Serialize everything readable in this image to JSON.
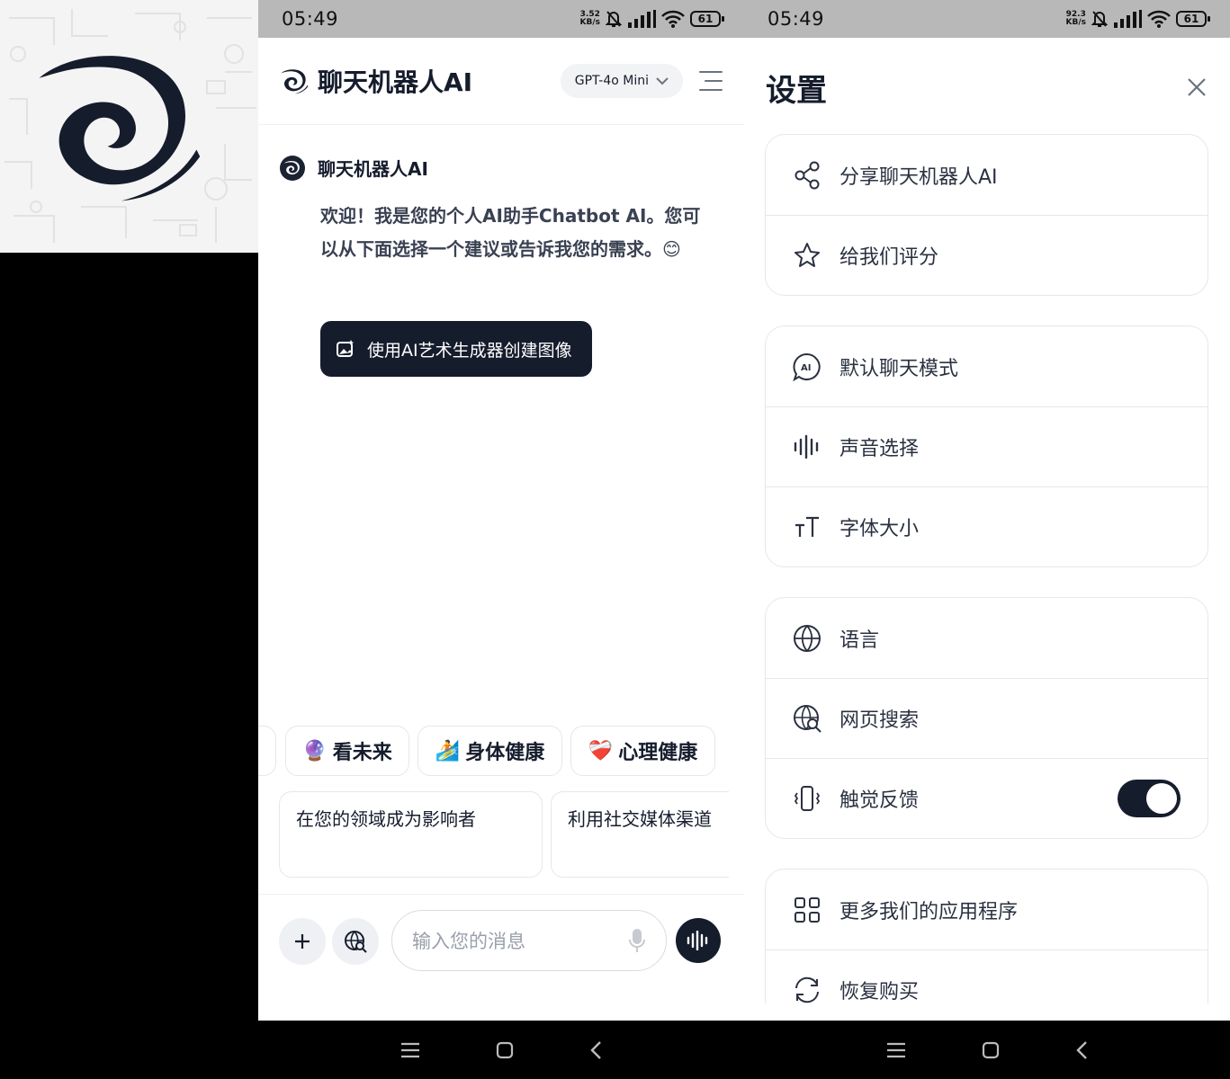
{
  "status_bar_left": {
    "time": "05:49",
    "speed_value": "3.52",
    "speed_unit": "KB/s",
    "battery": "61"
  },
  "status_bar_right": {
    "time": "05:49",
    "speed_value": "92.3",
    "speed_unit": "KB/s",
    "battery": "61"
  },
  "chat": {
    "app_title": "聊天机器人AI",
    "model": "GPT-4o Mini",
    "bot_name": "聊天机器人AI",
    "welcome": "欢迎！我是您的个人AI助手Chatbot AI。您可以从下面选择一个建议或告诉我您的需求。😊",
    "art_button": "使用AI艺术生成器创建图像",
    "chips": [
      {
        "emoji": "🔮",
        "label": "看未来"
      },
      {
        "emoji": "🏄",
        "label": "身体健康"
      },
      {
        "emoji": "❤️‍🩹",
        "label": "心理健康"
      }
    ],
    "prompts": [
      "在您的领域成为影响者",
      "利用社交媒体渠道"
    ],
    "input_placeholder": "输入您的消息"
  },
  "settings": {
    "title": "设置",
    "groups": [
      [
        {
          "icon": "share-icon",
          "label": "分享聊天机器人AI"
        },
        {
          "icon": "star-icon",
          "label": "给我们评分"
        }
      ],
      [
        {
          "icon": "ai-chat-icon",
          "label": "默认聊天模式"
        },
        {
          "icon": "waveform-icon",
          "label": "声音选择"
        },
        {
          "icon": "font-size-icon",
          "label": "字体大小"
        }
      ],
      [
        {
          "icon": "globe-icon",
          "label": "语言"
        },
        {
          "icon": "web-search-icon",
          "label": "网页搜索"
        },
        {
          "icon": "vibration-icon",
          "label": "触觉反馈",
          "toggle": true
        }
      ],
      [
        {
          "icon": "apps-grid-icon",
          "label": "更多我们的应用程序"
        },
        {
          "icon": "restore-icon",
          "label": "恢复购买"
        }
      ]
    ]
  },
  "colors": {
    "primary": "#151c2c",
    "border": "#e6e7ea",
    "status_bar": "#b8b8b8"
  }
}
